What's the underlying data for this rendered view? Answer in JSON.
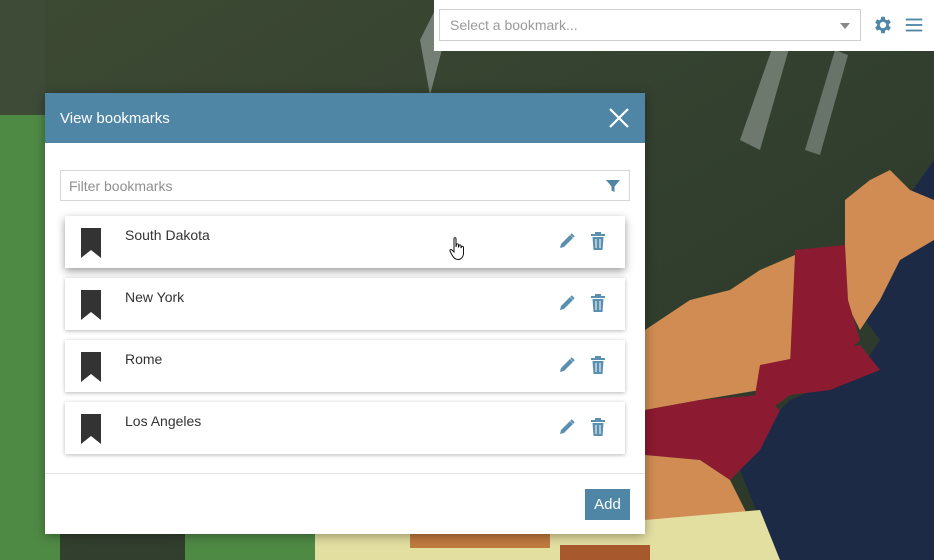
{
  "toolbar": {
    "bookmark_select_placeholder": "Select a bookmark...",
    "settings_icon": "gear-icon",
    "menu_icon": "hamburger-menu-icon"
  },
  "dialog": {
    "title": "View bookmarks",
    "close_icon": "close-icon",
    "filter_placeholder": "Filter bookmarks",
    "filter_icon": "filter-funnel-icon",
    "bookmarks": [
      {
        "label": "South Dakota"
      },
      {
        "label": "New York"
      },
      {
        "label": "Rome"
      },
      {
        "label": "Los Angeles"
      }
    ],
    "add_label": "Add"
  },
  "colors": {
    "accent": "#4f86a6",
    "icon_blue": "#5b8fb0",
    "bookmark_icon": "#333333",
    "map_orange": "#d08c52",
    "map_crimson": "#8c1a30",
    "map_ocean": "#1d2a45"
  }
}
